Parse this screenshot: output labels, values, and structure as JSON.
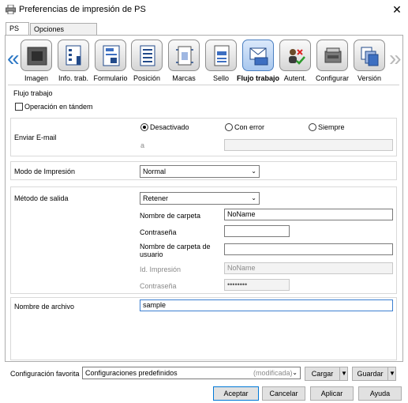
{
  "window": {
    "title": "Preferencias de impresión de PS"
  },
  "tabs": [
    "PS",
    "Opciones avanzadas"
  ],
  "toolbar": {
    "left_arrow": "«",
    "right_arrow": "»",
    "items": [
      {
        "label": "Imagen",
        "icon": "image-icon"
      },
      {
        "label": "Info. trab.",
        "icon": "job-info-icon"
      },
      {
        "label": "Formulario",
        "icon": "form-icon"
      },
      {
        "label": "Posición",
        "icon": "position-icon"
      },
      {
        "label": "Marcas",
        "icon": "marks-icon"
      },
      {
        "label": "Sello",
        "icon": "stamp-icon"
      },
      {
        "label": "Flujo trabajo",
        "icon": "workflow-icon"
      },
      {
        "label": "Autent.",
        "icon": "authentication-icon"
      },
      {
        "label": "Configurar",
        "icon": "configure-icon"
      },
      {
        "label": "Versión",
        "icon": "version-icon"
      }
    ],
    "selected": "Flujo trabajo"
  },
  "workflow": {
    "section_title": "Flujo trabajo",
    "tandem_label": "Operación en tándem",
    "tandem_checked": false,
    "email": {
      "label": "Enviar E-mail",
      "options": [
        "Desactivado",
        "Con error",
        "Siempre"
      ],
      "selected": "Desactivado",
      "to_label": "a",
      "to_value": ""
    },
    "print_mode": {
      "label": "Modo de Impresión",
      "value": "Normal"
    },
    "output": {
      "label": "Método de salida",
      "value": "Retener",
      "folder_name_label": "Nombre de carpeta",
      "folder_name_value": "NoName",
      "password_label": "Contraseña",
      "password_value": "",
      "user_folder_label": "Nombre de carpeta de usuario",
      "user_folder_value": "",
      "print_id_label": "Id. Impresión",
      "print_id_value": "NoName",
      "print_password_label": "Contraseña",
      "print_password_value": "••••••••"
    },
    "filename": {
      "label": "Nombre de archivo",
      "value": "sample"
    }
  },
  "favorites": {
    "label": "Configuración favorita",
    "value": "Configuraciones predefinidos",
    "modified": "(modificada)",
    "load": "Cargar",
    "save": "Guardar"
  },
  "buttons": {
    "ok": "Aceptar",
    "cancel": "Cancelar",
    "apply": "Aplicar",
    "help": "Ayuda"
  },
  "colors": {
    "accent": "#2b77c4",
    "selected_icon": "#a8c7ee",
    "focus_border": "#3c7fd1"
  }
}
